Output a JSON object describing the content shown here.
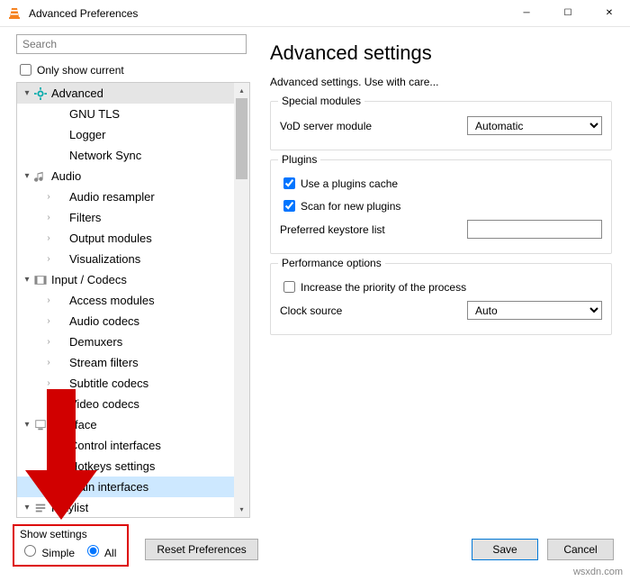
{
  "window": {
    "title": "Advanced Preferences"
  },
  "search": {
    "placeholder": "Search"
  },
  "only_current": {
    "label": "Only show current",
    "checked": false
  },
  "tree": {
    "items": [
      {
        "label": "Advanced",
        "lvl": 0,
        "tw": "▾",
        "icon": "gear",
        "cls": "advhdr"
      },
      {
        "label": "GNU TLS",
        "lvl": 1,
        "tw": ""
      },
      {
        "label": "Logger",
        "lvl": 1,
        "tw": ""
      },
      {
        "label": "Network Sync",
        "lvl": 1,
        "tw": ""
      },
      {
        "label": "Audio",
        "lvl": 0,
        "tw": "▾",
        "icon": "audio"
      },
      {
        "label": "Audio resampler",
        "lvl": 1,
        "tw": "›"
      },
      {
        "label": "Filters",
        "lvl": 1,
        "tw": "›"
      },
      {
        "label": "Output modules",
        "lvl": 1,
        "tw": "›"
      },
      {
        "label": "Visualizations",
        "lvl": 1,
        "tw": "›"
      },
      {
        "label": "Input / Codecs",
        "lvl": 0,
        "tw": "▾",
        "icon": "codec"
      },
      {
        "label": "Access modules",
        "lvl": 1,
        "tw": "›"
      },
      {
        "label": "Audio codecs",
        "lvl": 1,
        "tw": "›"
      },
      {
        "label": "Demuxers",
        "lvl": 1,
        "tw": "›"
      },
      {
        "label": "Stream filters",
        "lvl": 1,
        "tw": "›"
      },
      {
        "label": "Subtitle codecs",
        "lvl": 1,
        "tw": "›"
      },
      {
        "label": "Video codecs",
        "lvl": 1,
        "tw": "›"
      },
      {
        "label": "Interface",
        "lvl": 0,
        "tw": "▾",
        "icon": "iface"
      },
      {
        "label": "Control interfaces",
        "lvl": 1,
        "tw": "›"
      },
      {
        "label": "Hotkeys settings",
        "lvl": 1,
        "tw": ""
      },
      {
        "label": "Main interfaces",
        "lvl": 1,
        "tw": "›",
        "cls": "selected"
      },
      {
        "label": "Playlist",
        "lvl": 0,
        "tw": "▾",
        "icon": "playlist"
      }
    ]
  },
  "rp": {
    "title": "Advanced settings",
    "subtitle": "Advanced settings. Use with care...",
    "group1": {
      "legend": "Special modules",
      "vod_label": "VoD server module",
      "vod_value": "Automatic"
    },
    "group2": {
      "legend": "Plugins",
      "cache_label": "Use a plugins cache",
      "cache_checked": true,
      "scan_label": "Scan for new plugins",
      "scan_checked": true,
      "keystore_label": "Preferred keystore list",
      "keystore_value": ""
    },
    "group3": {
      "legend": "Performance options",
      "prio_label": "Increase the priority of the process",
      "prio_checked": false,
      "clock_label": "Clock source",
      "clock_value": "Auto"
    }
  },
  "bottom": {
    "show_settings_title": "Show settings",
    "simple_label": "Simple",
    "all_label": "All",
    "selected": "all",
    "reset_label": "Reset Preferences",
    "save_label": "Save",
    "cancel_label": "Cancel"
  },
  "watermark": "wsxdn.com"
}
